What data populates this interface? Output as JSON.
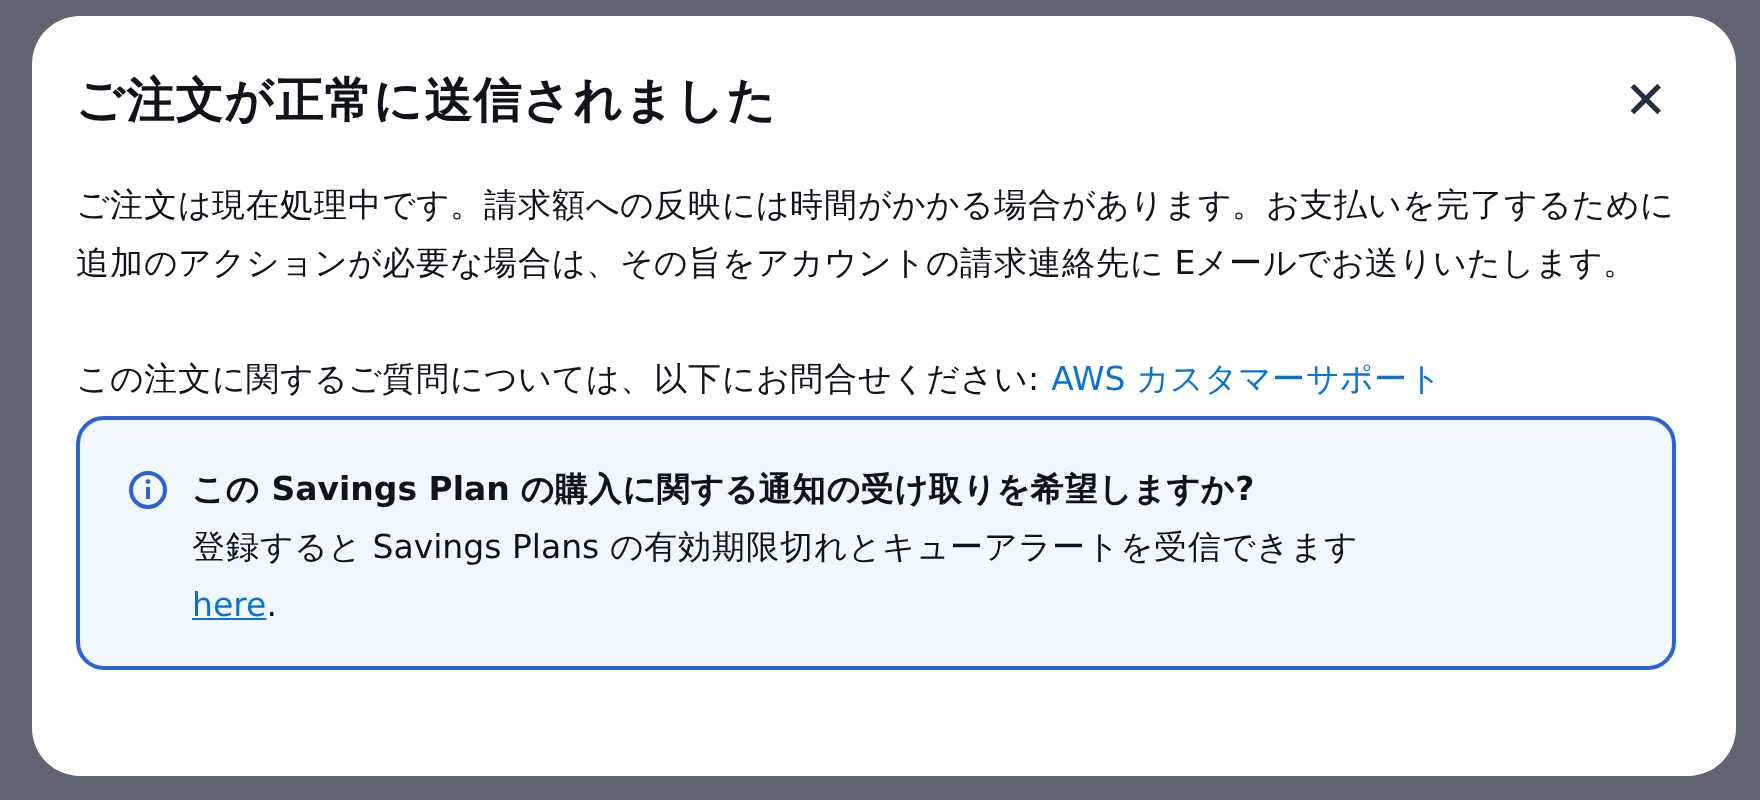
{
  "modal": {
    "title": "ご注文が正常に送信されました",
    "close_label": "✕",
    "message": "ご注文は現在処理中です。請求額への反映には時間がかかる場合があります。お支払いを完了するために追加のアクションが必要な場合は、その旨をアカウントの請求連絡先に Eメールでお送りいたします。",
    "contact_text": "この注文に関するご質問については、以下にお問合せください:",
    "contact_link": "AWS カスタマーサポート",
    "alert": {
      "kind": "info",
      "heading": "この Savings Plan の購入に関する通知の受け取りを希望しますか?",
      "text": "登録すると Savings Plans の有効期限切れとキューアラートを受信できます",
      "link": "here",
      "after_link": "."
    }
  }
}
